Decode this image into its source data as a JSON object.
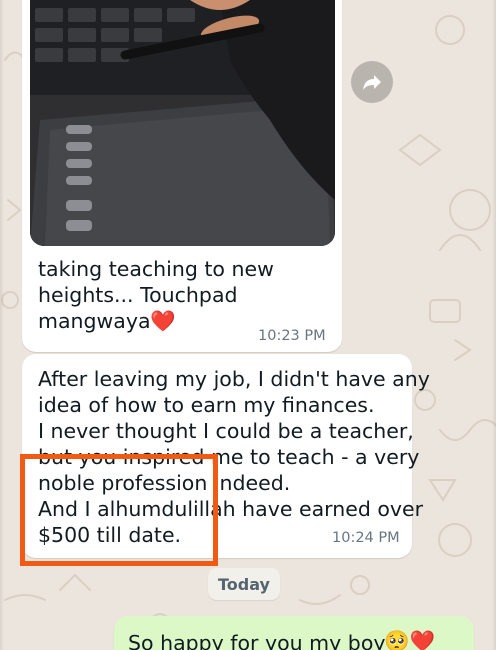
{
  "chat": {
    "messages": [
      {
        "direction": "incoming",
        "has_photo": true,
        "photo_description_icon": "drawing-tablet-photo",
        "text": "taking teaching to new\nheights... Touchpad\nmangwaya",
        "emoji": "❤️",
        "time": "10:23 PM"
      },
      {
        "direction": "incoming",
        "text": "After leaving my job, I didn't have any\nidea of how to earn my finances.\nI never thought I could be a teacher,\nbut you inspired me to teach - a very\nnoble profession indeed.\nAnd I alhumdulillah have earned over\n$500 till date.",
        "time": "10:24 PM"
      },
      {
        "direction": "outgoing",
        "text": "So happy for you my boyy.",
        "emoji": "🥺❤️"
      }
    ],
    "day_separator": "Today",
    "forward_icon": "forward-arrow-icon"
  },
  "colors": {
    "wallpaper": "#ece5dd",
    "incoming_bubble": "#ffffff",
    "outgoing_bubble": "#dcf8c6",
    "highlight": "#f05a12",
    "time_text": "#667781"
  }
}
